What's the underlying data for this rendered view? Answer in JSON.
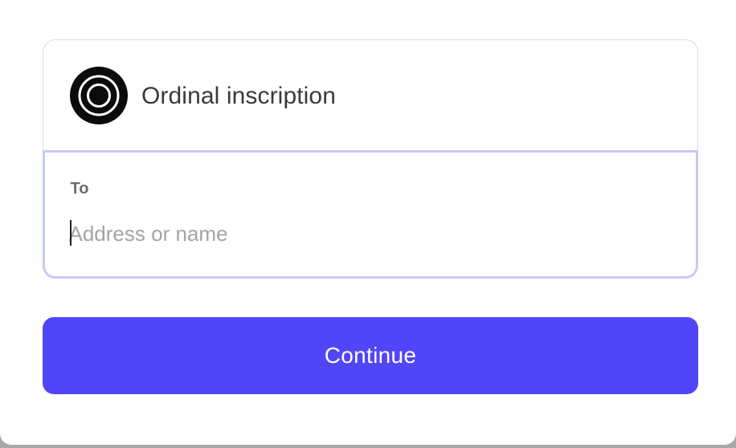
{
  "asset": {
    "icon": "ordinal-icon",
    "label": "Ordinal inscription"
  },
  "recipient": {
    "label": "To",
    "value": "",
    "placeholder": "Address or name"
  },
  "actions": {
    "continue_label": "Continue"
  },
  "colors": {
    "accent": "#5046f7",
    "focus_border": "#c6cbf3",
    "card_border": "#dcdce0",
    "text_primary": "#3a3a3e",
    "placeholder": "#a3a3a9"
  }
}
